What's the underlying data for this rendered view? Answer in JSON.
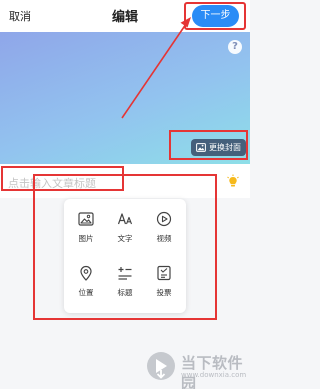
{
  "header": {
    "cancel_label": "取消",
    "title": "编辑",
    "next_label": "下一步"
  },
  "cover": {
    "help_label": "?",
    "change_cover_label": "更换封面"
  },
  "article": {
    "title_placeholder": "点击输入文章标题"
  },
  "insert_menu": {
    "items": [
      {
        "label": "图片",
        "icon": "image-icon"
      },
      {
        "label": "文字",
        "icon": "text-icon"
      },
      {
        "label": "视频",
        "icon": "video-icon"
      },
      {
        "label": "位置",
        "icon": "location-icon"
      },
      {
        "label": "标题",
        "icon": "heading-icon"
      },
      {
        "label": "投票",
        "icon": "vote-icon"
      }
    ]
  },
  "watermark": {
    "name": "当下软件园",
    "site": "www.downxia.com"
  },
  "colors": {
    "accent": "#2a8cf6",
    "annotation": "#e53535",
    "cover_gradient": [
      "#8fa6e9",
      "#92c3ef",
      "#8edfe8"
    ]
  }
}
